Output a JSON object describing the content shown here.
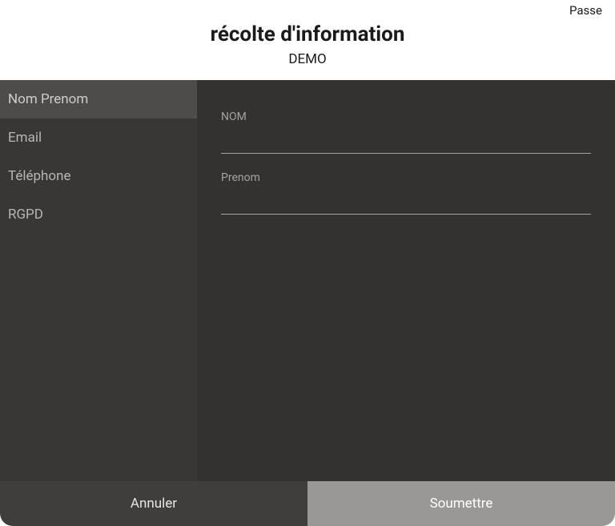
{
  "header": {
    "skip_label": "Passe",
    "title": "récolte d'information",
    "subtitle": "DEMO"
  },
  "sidebar": {
    "items": [
      {
        "label": "Nom Prenom",
        "active": true
      },
      {
        "label": "Email",
        "active": false
      },
      {
        "label": "Téléphone",
        "active": false
      },
      {
        "label": "RGPD",
        "active": false
      }
    ]
  },
  "form": {
    "fields": [
      {
        "label": "NOM",
        "value": ""
      },
      {
        "label": "Prenom",
        "value": ""
      }
    ]
  },
  "footer": {
    "cancel_label": "Annuler",
    "submit_label": "Soumettre"
  }
}
